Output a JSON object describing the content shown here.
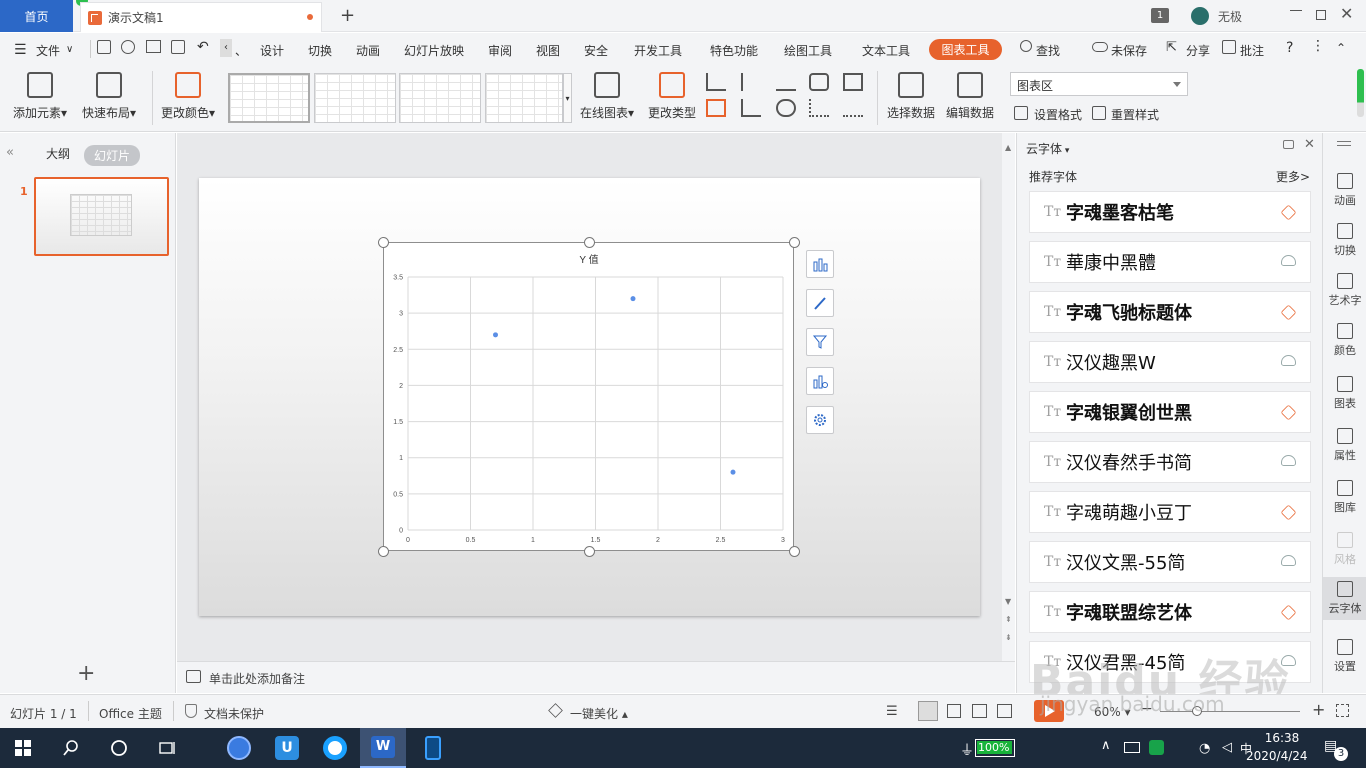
{
  "titlebar": {
    "home_tab": "首页",
    "doc_tab": "演示文稿1",
    "badge": "1",
    "user": "无极"
  },
  "menu": {
    "items": [
      "文件",
      "设计",
      "切换",
      "动画",
      "幻灯片放映",
      "审阅",
      "视图",
      "安全",
      "开发工具",
      "特色功能",
      "绘图工具",
      "文本工具"
    ],
    "active_tab": "图表工具",
    "search": "查找",
    "unsaved": "未保存",
    "share": "分享",
    "annotate": "批注"
  },
  "ribbon": {
    "add_element": "添加元素",
    "quick_layout": "快速布局",
    "change_color": "更改颜色",
    "online_chart": "在线图表",
    "change_type": "更改类型",
    "select_data": "选择数据",
    "edit_data": "编辑数据",
    "chart_area": "图表区",
    "set_format": "设置格式",
    "reset_style": "重置样式"
  },
  "left_panel": {
    "outline_tab": "大纲",
    "slides_tab": "幻灯片",
    "slide_number": "1",
    "add_icon": "+"
  },
  "chart_data": {
    "type": "scatter",
    "title": "Y 值",
    "x": [
      0.7,
      1.8,
      2.6
    ],
    "y": [
      2.7,
      3.2,
      0.8
    ],
    "xlim": [
      0,
      3
    ],
    "ylim": [
      0,
      3.5
    ],
    "x_ticks": [
      "0",
      "0.5",
      "1",
      "1.5",
      "2",
      "2.5",
      "3"
    ],
    "y_ticks": [
      "0",
      "0.5",
      "1",
      "1.5",
      "2",
      "2.5",
      "3",
      "3.5"
    ],
    "grid": true,
    "point_color": "#5b8fe6"
  },
  "notes": {
    "placeholder": "单击此处添加备注"
  },
  "right_panel": {
    "title": "云字体",
    "recommended": "推荐字体",
    "more": "更多>",
    "fonts": [
      {
        "name": "字魂墨客枯笔",
        "status": "premium"
      },
      {
        "name": "華康中黑體",
        "status": "cloud"
      },
      {
        "name": "字魂飞驰标题体",
        "status": "premium"
      },
      {
        "name": "汉仪趣黑W",
        "status": "cloud"
      },
      {
        "name": "字魂银翼创世黑",
        "status": "premium"
      },
      {
        "name": "汉仪春然手书简",
        "status": "cloud"
      },
      {
        "name": "字魂萌趣小豆丁",
        "status": "premium"
      },
      {
        "name": "汉仪文黑-55简",
        "status": "cloud"
      },
      {
        "name": "字魂联盟综艺体",
        "status": "premium"
      },
      {
        "name": "汉仪君黑-45简",
        "status": "cloud"
      }
    ]
  },
  "sidebar": {
    "items": [
      "动画",
      "切换",
      "艺术字",
      "颜色",
      "图表",
      "属性",
      "图库",
      "风格",
      "云字体",
      "设置"
    ]
  },
  "statusbar": {
    "slide_info": "幻灯片 1 / 1",
    "theme": "Office 主题",
    "protection": "文档未保护",
    "beautify": "一键美化",
    "zoom": "60%"
  },
  "taskbar": {
    "battery": "100%",
    "time": "16:38",
    "date": "2020/4/24",
    "notifications": "3"
  },
  "watermark": {
    "brand": "Baidu 经验",
    "url": "jingyan.baidu.com"
  },
  "colors": {
    "accent": "#e7622c",
    "home_blue": "#2c68c7",
    "premium_icon": "#e7622c"
  }
}
